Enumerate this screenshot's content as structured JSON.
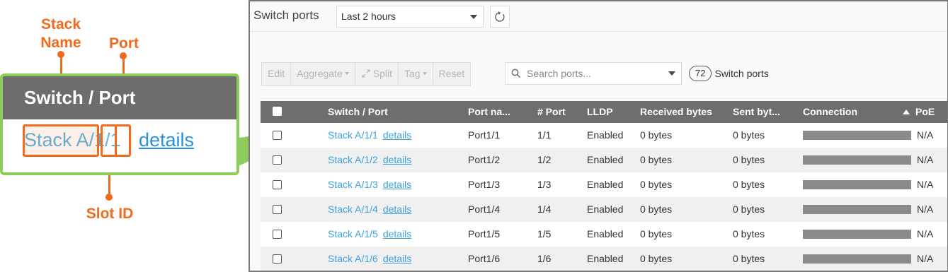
{
  "callout": {
    "stack_name_label": "Stack\nName",
    "port_label": "Port",
    "slot_id_label": "Slot ID",
    "header": "Switch / Port",
    "stack_text": "Stack A",
    "slash1": "/",
    "slot_value": "1",
    "slash2": "/",
    "port_value": "1",
    "details": "details",
    "accent_color": "#f26b1d",
    "frame_color": "#8dcc5c"
  },
  "panel": {
    "title": "Switch ports",
    "time_range": "Last 2 hours",
    "toolbar": {
      "edit": "Edit",
      "aggregate": "Aggregate",
      "split": "Split",
      "tag": "Tag",
      "reset": "Reset"
    },
    "search_placeholder": "Search ports...",
    "count": "72",
    "count_label": "Switch ports"
  },
  "table": {
    "columns": [
      "Switch / Port",
      "Port na...",
      "# Port",
      "LLDP",
      "Received bytes",
      "Sent byt...",
      "Connection",
      "PoE"
    ],
    "sorted_column": "PoE",
    "rows": [
      {
        "switch_port": "Stack A/1/1",
        "details": "details",
        "port_name": "Port1/1",
        "port": "1/1",
        "lldp": "Enabled",
        "received": "0 bytes",
        "sent": "0 bytes",
        "poe": "N/A"
      },
      {
        "switch_port": "Stack A/1/2",
        "details": "details",
        "port_name": "Port1/2",
        "port": "1/2",
        "lldp": "Enabled",
        "received": "0 bytes",
        "sent": "0 bytes",
        "poe": "N/A"
      },
      {
        "switch_port": "Stack A/1/3",
        "details": "details",
        "port_name": "Port1/3",
        "port": "1/3",
        "lldp": "Enabled",
        "received": "0 bytes",
        "sent": "0 bytes",
        "poe": "N/A"
      },
      {
        "switch_port": "Stack A/1/4",
        "details": "details",
        "port_name": "Port1/4",
        "port": "1/4",
        "lldp": "Enabled",
        "received": "0 bytes",
        "sent": "0 bytes",
        "poe": "N/A"
      },
      {
        "switch_port": "Stack A/1/5",
        "details": "details",
        "port_name": "Port1/5",
        "port": "1/5",
        "lldp": "Enabled",
        "received": "0 bytes",
        "sent": "0 bytes",
        "poe": "N/A"
      },
      {
        "switch_port": "Stack A/1/6",
        "details": "details",
        "port_name": "Port1/6",
        "port": "1/6",
        "lldp": "Enabled",
        "received": "0 bytes",
        "sent": "0 bytes",
        "poe": "N/A"
      }
    ]
  }
}
